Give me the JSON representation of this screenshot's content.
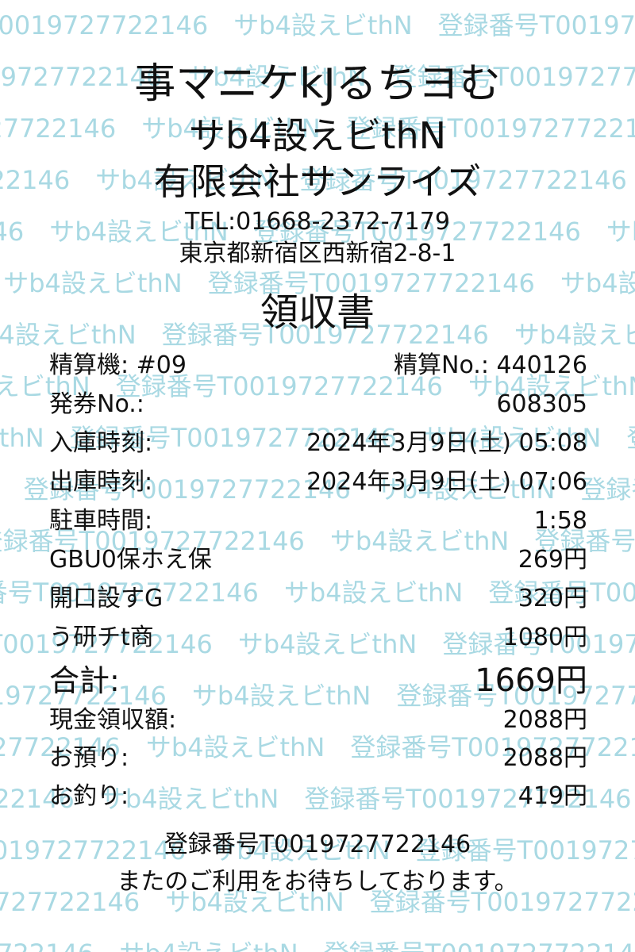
{
  "header": {
    "store_line1": "事マニケkJるちヨむ",
    "store_line2": "サb4設えビthN",
    "company": "有限会社サンライズ",
    "tel": "TEL:01668-2372-7179",
    "address": "東京都新宿区西新宿2-8-1"
  },
  "title": "領収書",
  "details": [
    {
      "label": "精算機: #09",
      "value": "精算No.: 440126"
    },
    {
      "label": "発券No.:",
      "value": "608305"
    },
    {
      "label": "入庫時刻:",
      "value": "2024年3月9日(土) 05:08"
    },
    {
      "label": "出庫時刻:",
      "value": "2024年3月9日(土) 07:06"
    },
    {
      "label": "駐車時間:",
      "value": "1:58"
    },
    {
      "label": "GBU0保ホえ保",
      "value": "269円"
    },
    {
      "label": "開口設すG",
      "value": "320円"
    },
    {
      "label": "う研チt商",
      "value": "1080円"
    }
  ],
  "total": {
    "label": "合計:",
    "value": "1669円"
  },
  "payment": [
    {
      "label": "現金領収額:",
      "value": "2088円"
    },
    {
      "label": "お預り:",
      "value": "2088円"
    },
    {
      "label": "お釣り:",
      "value": "419円"
    }
  ],
  "footer": {
    "registration": "登録番号T0019727722146",
    "thanks": "またのご利用をお待ちしております。"
  },
  "watermark": {
    "text": "登録番号T0019727722146　サb4設えビthN　",
    "color": "#a9d9e3"
  }
}
